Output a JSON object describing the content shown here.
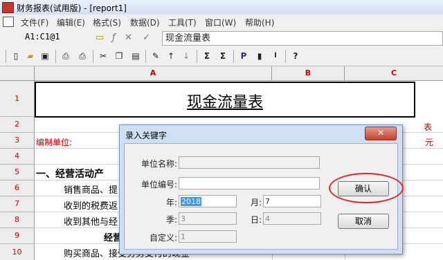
{
  "window": {
    "title": "财务报表(试用版) - [report1]"
  },
  "menu": {
    "items": [
      "文件(F)",
      "编辑(E)",
      "格式(S)",
      "数据(D)",
      "工具(T)",
      "窗口(W)",
      "帮助(H)"
    ]
  },
  "formula_bar": {
    "cell_ref": "A1:C1@1",
    "content": "现金流量表",
    "icons": [
      "fx-icon",
      "cancel-icon",
      "accept-icon"
    ]
  },
  "toolbar": {
    "icons": [
      "new-icon",
      "open-icon",
      "save-icon",
      "preview-icon",
      "print-icon",
      "cut-icon",
      "copy-icon",
      "paste-icon",
      "format-painter-icon",
      "sort-asc-icon",
      "sort-desc-icon",
      "sum-icon",
      "sum-range-icon",
      "p-icon",
      "bookmark-icon",
      "log-icon",
      "help-icon"
    ]
  },
  "sheet": {
    "columns": [
      "A",
      "B",
      "C"
    ],
    "rows": [
      "1",
      "2",
      "3",
      "4",
      "5",
      "6",
      "7",
      "8",
      "9",
      "10"
    ],
    "title": "现金流量表",
    "row2_right": "表",
    "row3_left": "编制单位:",
    "row3_right": "元",
    "row5": "一、经营活动产",
    "row6": "销售商品、提",
    "row7": "收到的税费返",
    "row8": "收到其他与经",
    "row9": "经营活",
    "row10": "购买商品、接受劳务支付的现金"
  },
  "dialog": {
    "title": "录入关键字",
    "close": "✕",
    "fields": {
      "unit_name_label": "单位名称:",
      "unit_code_label": "单位编号:",
      "year_label": "年:",
      "year_value": "2018",
      "month_label": "月:",
      "month_value": "7",
      "quarter_label": "季:",
      "quarter_value": "3",
      "day_label": "日:",
      "day_value": "4",
      "custom_label": "自定义:",
      "custom_value": "1"
    },
    "confirm": "确认",
    "cancel": "取消"
  },
  "colors": {
    "accent": "#e0252a",
    "header_text": "#cc0000"
  }
}
